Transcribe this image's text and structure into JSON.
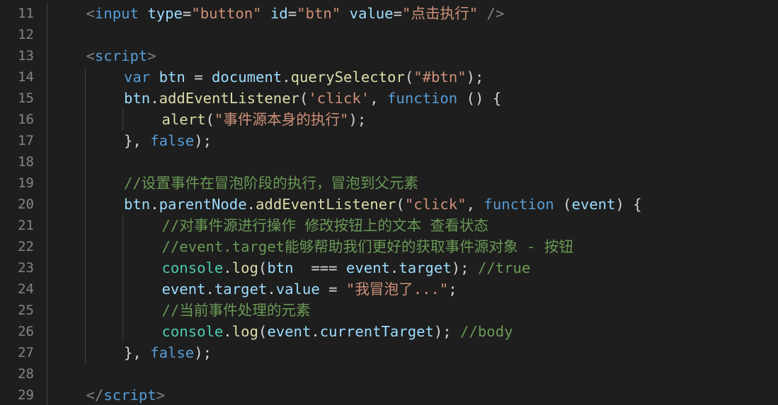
{
  "editor": {
    "lines": [
      {
        "number": "11",
        "indent": 1,
        "tokens": [
          [
            "tag",
            "<"
          ],
          [
            "tagname",
            "input"
          ],
          [
            "punct",
            " "
          ],
          [
            "attr",
            "type"
          ],
          [
            "punct",
            "="
          ],
          [
            "str",
            "\"button\""
          ],
          [
            "punct",
            " "
          ],
          [
            "attr",
            "id"
          ],
          [
            "punct",
            "="
          ],
          [
            "str",
            "\"btn\""
          ],
          [
            "punct",
            " "
          ],
          [
            "attr",
            "value"
          ],
          [
            "punct",
            "="
          ],
          [
            "str",
            "\"点击执行\""
          ],
          [
            "punct",
            " "
          ],
          [
            "tag",
            "/>"
          ]
        ]
      },
      {
        "number": "12",
        "indent": 0,
        "tokens": []
      },
      {
        "number": "13",
        "indent": 1,
        "tokens": [
          [
            "tag",
            "<"
          ],
          [
            "tagname",
            "script"
          ],
          [
            "tag",
            ">"
          ]
        ]
      },
      {
        "number": "14",
        "indent": 2,
        "tokens": [
          [
            "kw",
            "var"
          ],
          [
            "punct",
            " "
          ],
          [
            "var",
            "btn"
          ],
          [
            "punct",
            " = "
          ],
          [
            "var",
            "document"
          ],
          [
            "punct",
            "."
          ],
          [
            "fn",
            "querySelector"
          ],
          [
            "punct",
            "("
          ],
          [
            "str",
            "\"#btn\""
          ],
          [
            "punct",
            ");"
          ]
        ]
      },
      {
        "number": "15",
        "indent": 2,
        "tokens": [
          [
            "var",
            "btn"
          ],
          [
            "punct",
            "."
          ],
          [
            "fn",
            "addEventListener"
          ],
          [
            "punct",
            "("
          ],
          [
            "str",
            "'click'"
          ],
          [
            "punct",
            ", "
          ],
          [
            "kw",
            "function"
          ],
          [
            "punct",
            " () {"
          ]
        ]
      },
      {
        "number": "16",
        "indent": 3,
        "tokens": [
          [
            "fn",
            "alert"
          ],
          [
            "punct",
            "("
          ],
          [
            "str",
            "\"事件源本身的执行\""
          ],
          [
            "punct",
            ");"
          ]
        ]
      },
      {
        "number": "17",
        "indent": 2,
        "tokens": [
          [
            "punct",
            "}, "
          ],
          [
            "kw",
            "false"
          ],
          [
            "punct",
            ");"
          ]
        ]
      },
      {
        "number": "18",
        "indent": 0,
        "tokens": []
      },
      {
        "number": "19",
        "indent": 2,
        "tokens": [
          [
            "cmt",
            "//设置事件在冒泡阶段的执行，冒泡到父元素"
          ]
        ]
      },
      {
        "number": "20",
        "indent": 2,
        "tokens": [
          [
            "var",
            "btn"
          ],
          [
            "punct",
            "."
          ],
          [
            "var",
            "parentNode"
          ],
          [
            "punct",
            "."
          ],
          [
            "fn",
            "addEventListener"
          ],
          [
            "punct",
            "("
          ],
          [
            "str",
            "\"click\""
          ],
          [
            "punct",
            ", "
          ],
          [
            "kw",
            "function"
          ],
          [
            "punct",
            " ("
          ],
          [
            "var",
            "event"
          ],
          [
            "punct",
            ") {"
          ]
        ]
      },
      {
        "number": "21",
        "indent": 3,
        "tokens": [
          [
            "cmt",
            "//对事件源进行操作 修改按钮上的文本 查看状态"
          ]
        ]
      },
      {
        "number": "22",
        "indent": 3,
        "tokens": [
          [
            "cmt",
            "//event.target能够帮助我们更好的获取事件源对象 - 按钮"
          ]
        ]
      },
      {
        "number": "23",
        "indent": 3,
        "tokens": [
          [
            "cls",
            "console"
          ],
          [
            "punct",
            "."
          ],
          [
            "fn",
            "log"
          ],
          [
            "punct",
            "("
          ],
          [
            "var",
            "btn"
          ],
          [
            "punct",
            "  === "
          ],
          [
            "var",
            "event"
          ],
          [
            "punct",
            "."
          ],
          [
            "var",
            "target"
          ],
          [
            "punct",
            "); "
          ],
          [
            "cmt",
            "//true"
          ]
        ]
      },
      {
        "number": "24",
        "indent": 3,
        "tokens": [
          [
            "var",
            "event"
          ],
          [
            "punct",
            "."
          ],
          [
            "var",
            "target"
          ],
          [
            "punct",
            "."
          ],
          [
            "var",
            "value"
          ],
          [
            "punct",
            " = "
          ],
          [
            "str",
            "\"我冒泡了...\""
          ],
          [
            "punct",
            ";"
          ]
        ]
      },
      {
        "number": "25",
        "indent": 3,
        "tokens": [
          [
            "cmt",
            "//当前事件处理的元素"
          ]
        ]
      },
      {
        "number": "26",
        "indent": 3,
        "tokens": [
          [
            "cls",
            "console"
          ],
          [
            "punct",
            "."
          ],
          [
            "fn",
            "log"
          ],
          [
            "punct",
            "("
          ],
          [
            "var",
            "event"
          ],
          [
            "punct",
            "."
          ],
          [
            "var",
            "currentTarget"
          ],
          [
            "punct",
            "); "
          ],
          [
            "cmt",
            "//body"
          ]
        ]
      },
      {
        "number": "27",
        "indent": 2,
        "tokens": [
          [
            "punct",
            "}, "
          ],
          [
            "kw",
            "false"
          ],
          [
            "punct",
            ");"
          ]
        ]
      },
      {
        "number": "28",
        "indent": 0,
        "tokens": []
      },
      {
        "number": "29",
        "indent": 1,
        "tokens": [
          [
            "tag",
            "</"
          ],
          [
            "tagname",
            "script"
          ],
          [
            "tag",
            ">"
          ]
        ]
      }
    ]
  }
}
